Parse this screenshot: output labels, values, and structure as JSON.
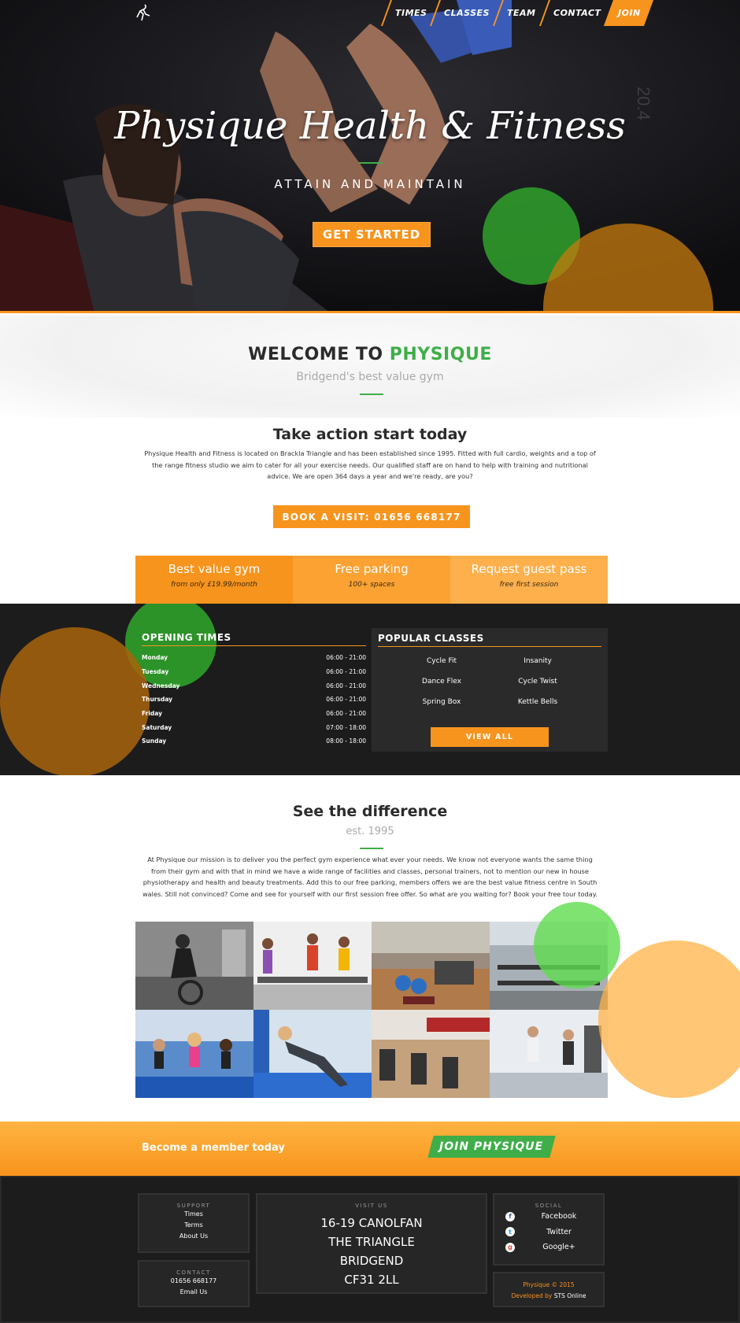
{
  "nav": {
    "items": [
      {
        "label": "TIMES"
      },
      {
        "label": "CLASSES"
      },
      {
        "label": "TEAM"
      },
      {
        "label": "CONTACT"
      },
      {
        "label": "JOIN"
      }
    ]
  },
  "hero": {
    "title": "Physique Health & Fitness",
    "subtitle": "ATTAIN AND MAINTAIN",
    "cta": "GET STARTED"
  },
  "welcome": {
    "title_prefix": "WELCOME TO ",
    "title_accent": "PHYSIQUE",
    "tagline": "Bridgend's best value gym",
    "heading": "Take action start today",
    "body": "Physique Health and Fitness is located on Brackla Triangle and has been established since 1995. Fitted with full cardio, weights and a top of the range fitness studio we aim to cater for all your exercise needs. Our qualified staff are on hand to help with training and nutritional advice. We are open 364 days a year and we're ready, are you?",
    "book_button": "BOOK A VISIT: 01656 668177"
  },
  "features": [
    {
      "title": "Best value gym",
      "sub": "from only £19.99/month",
      "color": "#f7941d"
    },
    {
      "title": "Free parking",
      "sub": "100+ spaces",
      "color": "#fba233"
    },
    {
      "title": "Request guest pass",
      "sub": "free first session",
      "color": "#fdb04c"
    }
  ],
  "opening_times": {
    "title": "OPENING TIMES",
    "rows": [
      {
        "day": "Monday",
        "hours": "06:00 - 21:00"
      },
      {
        "day": "Tuesday",
        "hours": "06:00 - 21:00"
      },
      {
        "day": "Wednesday",
        "hours": "06:00 - 21:00"
      },
      {
        "day": "Thursday",
        "hours": "06:00 - 21:00"
      },
      {
        "day": "Friday",
        "hours": "06:00 - 21:00"
      },
      {
        "day": "Saturday",
        "hours": "07:00 - 18:00"
      },
      {
        "day": "Sunday",
        "hours": "08:00 - 18:00"
      }
    ]
  },
  "popular_classes": {
    "title": "POPULAR CLASSES",
    "items": [
      "Cycle Fit",
      "Insanity",
      "Dance Flex",
      "Cycle Twist",
      "Spring Box",
      "Kettle Bells"
    ],
    "button": "VIEW ALL"
  },
  "difference": {
    "heading": "See the difference",
    "tagline": "est. 1995",
    "body": "At Physique our mission is to deliver you the perfect gym experience what ever your needs. We know not everyone wants the same thing from their gym and with that in mind we have a wide range of facilities and classes, personal trainers, not to mention our new in house physiotherapy and health and beauty treatments. Add this to our free parking, members offers we are the best value fitness centre in South wales. Still not convinced? Come and see for yourself with our first session free offer. So what are you waiting for? Book your free tour today."
  },
  "cta": {
    "text": "Become a member today",
    "button": "JOIN PHYSIQUE"
  },
  "footer": {
    "support": {
      "title": "SUPPORT",
      "links": [
        "Times",
        "Terms",
        "About Us"
      ]
    },
    "contact": {
      "title": "CONTACT",
      "phone": "01656 668177",
      "email": "Email Us"
    },
    "visit": {
      "title": "VISIT US",
      "lines": [
        "16-19 CANOLFAN",
        "THE TRIANGLE",
        "BRIDGEND",
        "CF31 2LL"
      ]
    },
    "social": {
      "title": "SOCIAL",
      "links": [
        {
          "label": "Facebook",
          "icon": "facebook-icon",
          "color": "#3b5998"
        },
        {
          "label": "Twitter",
          "icon": "twitter-icon",
          "color": "#1da1f2"
        },
        {
          "label": "Google+",
          "icon": "googleplus-icon",
          "color": "#dd4b39"
        }
      ]
    },
    "copyright": "Physique © 2015",
    "developed_prefix": "Developed by",
    "developer": "STS Online"
  },
  "colors": {
    "accent": "#f7941d",
    "green": "#3fae49",
    "dark": "#1c1c1c"
  }
}
